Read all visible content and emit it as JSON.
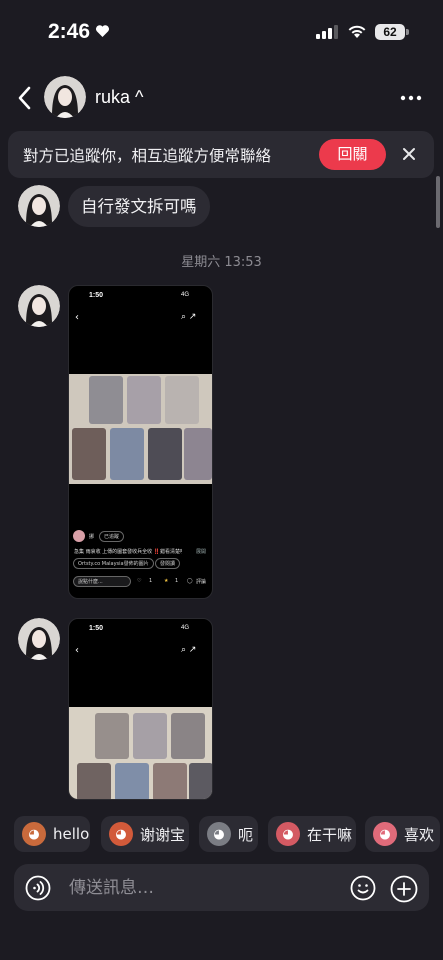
{
  "status_bar": {
    "time": "2:46",
    "battery": "62",
    "icons": [
      "heart-icon",
      "signal-icon",
      "wifi-icon",
      "battery-icon"
    ]
  },
  "header": {
    "username": "ruka ^",
    "icons": [
      "chevron-left-icon",
      "more-horizontal-icon"
    ]
  },
  "follow_banner": {
    "text": "對方已追蹤你，相互追蹤方便常聯絡",
    "button_label": "回關"
  },
  "messages": [
    {
      "type": "text",
      "text": "自行發文拆可嗎"
    },
    {
      "type": "timestamp",
      "text": "星期六 13:53"
    },
    {
      "type": "image",
      "screenshot": {
        "time": "1:50",
        "status": "4G",
        "user_tag": "挪",
        "badge": "已追蹤",
        "caption": "急集 雨哀收 上傳的圖套發收兵全收 ‼️錯看清楚哦...",
        "more": "展開",
        "link_text": "Ortsty.co Malaysia發佈的圖片",
        "link_tag": "發閱讀",
        "comment_placeholder": "說點什麼...",
        "likes": "1",
        "stars": "1",
        "comments_label": "評論"
      }
    },
    {
      "type": "image",
      "screenshot": {
        "time": "1:50",
        "status": "4G"
      }
    }
  ],
  "quick_replies": [
    {
      "label": "hello",
      "icon": "monkey-sticker-icon",
      "color": "#c96a3c"
    },
    {
      "label": "谢谢宝",
      "icon": "monkey-bow-sticker-icon",
      "color": "#d25a3a"
    },
    {
      "label": "呃",
      "icon": "cat-sticker-icon",
      "color": "#7b7d84"
    },
    {
      "label": "在干嘛",
      "icon": "girl-sticker-icon",
      "color": "#d45a63"
    },
    {
      "label": "喜欢",
      "icon": "heart-girl-sticker-icon",
      "color": "#e06b7a"
    }
  ],
  "composer": {
    "placeholder": "傳送訊息…",
    "icons": [
      "voice-icon",
      "emoji-icon",
      "add-icon"
    ]
  }
}
